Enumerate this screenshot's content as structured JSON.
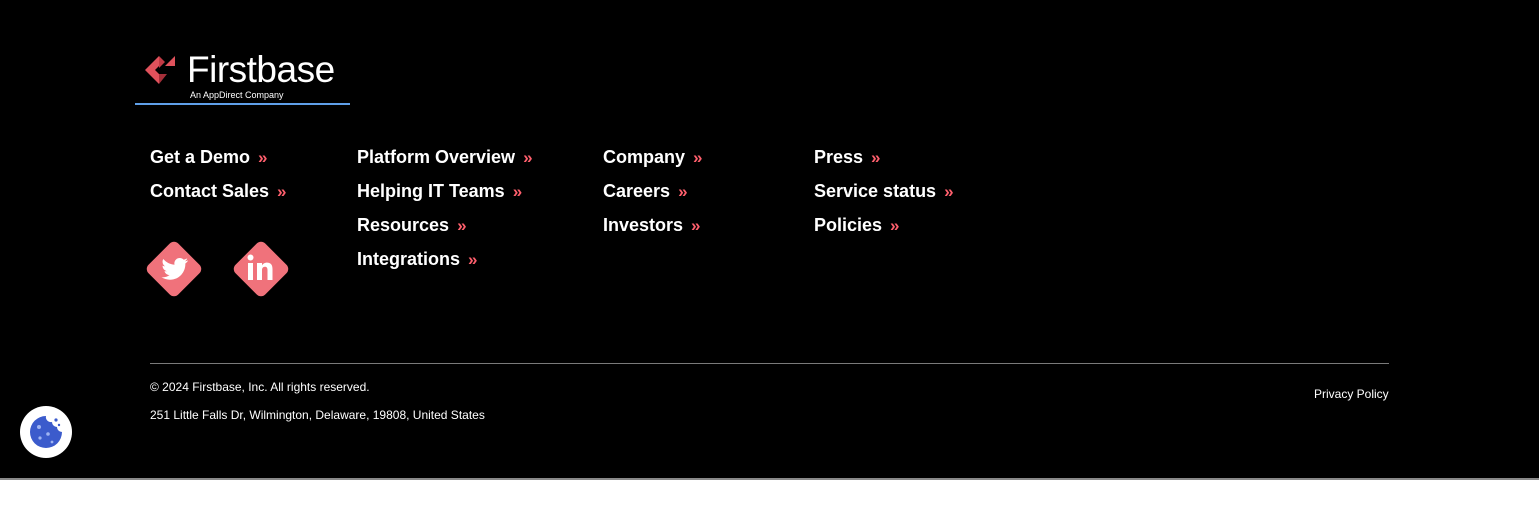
{
  "brand": {
    "name": "Firstbase",
    "tagline": "An AppDirect Company",
    "accent_color": "#ff5f6d",
    "logo_underline_color": "#5f9fe8"
  },
  "nav": {
    "arrow": "»",
    "col1": [
      {
        "label": "Get a Demo"
      },
      {
        "label": "Contact Sales"
      }
    ],
    "col2": [
      {
        "label": "Platform Overview"
      },
      {
        "label": "Helping IT Teams"
      },
      {
        "label": "Resources"
      },
      {
        "label": "Integrations"
      }
    ],
    "col3": [
      {
        "label": "Company"
      },
      {
        "label": "Careers"
      },
      {
        "label": "Investors"
      }
    ],
    "col4": [
      {
        "label": "Press"
      },
      {
        "label": "Service status"
      },
      {
        "label": "Policies"
      }
    ]
  },
  "social": [
    {
      "icon": "twitter-icon"
    },
    {
      "icon": "linkedin-icon"
    }
  ],
  "legal": {
    "copyright": "© 2024 Firstbase, Inc. All rights reserved.",
    "address": "251 Little Falls Dr, Wilmington, Delaware, 19808, United States",
    "privacy_label": "Privacy Policy"
  },
  "cookie": {
    "icon": "cookie-icon"
  }
}
